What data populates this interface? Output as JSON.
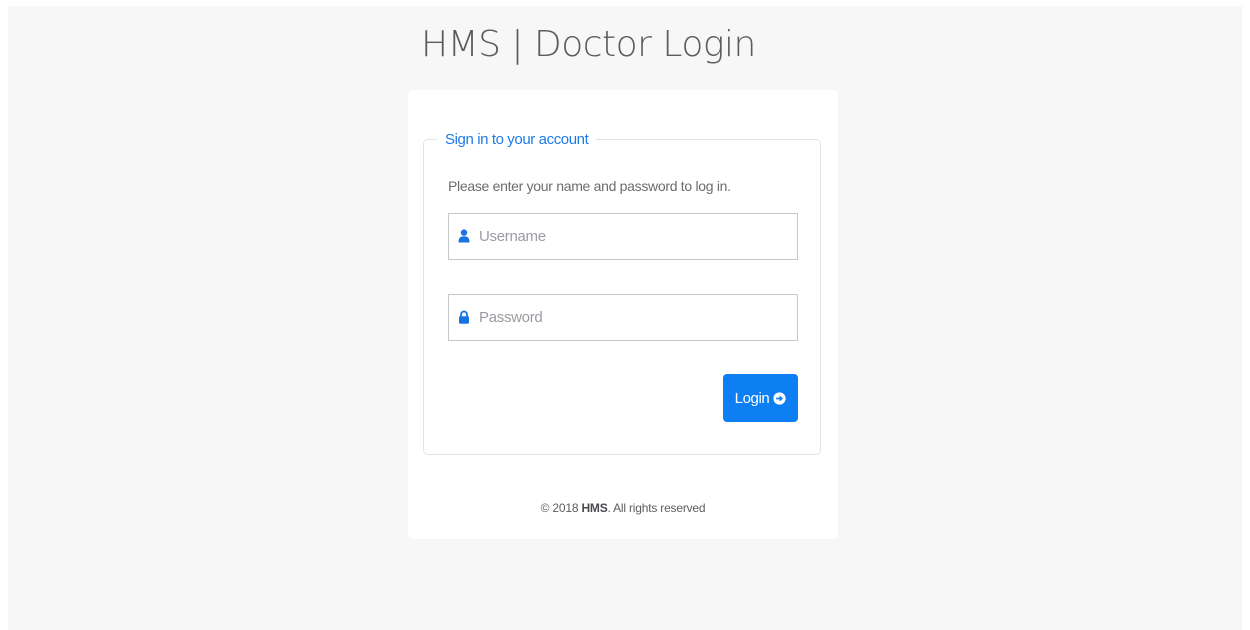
{
  "page": {
    "title": "HMS | Doctor Login"
  },
  "form": {
    "legend": "Sign in to your account",
    "instruction": "Please enter your name and password to log in.",
    "username": {
      "placeholder": "Username",
      "value": "",
      "icon": "user-icon"
    },
    "password": {
      "placeholder": "Password",
      "value": "",
      "icon": "lock-icon"
    },
    "submit": {
      "label": "Login",
      "icon": "arrow-circle-right-icon"
    }
  },
  "footer": {
    "prefix": "© 2018 ",
    "brand": "HMS",
    "suffix": ". All rights reserved"
  },
  "colors": {
    "accent": "#0d7ff2",
    "legend_text": "#1e7be6",
    "page_background": "#f7f7f8",
    "card_background": "#ffffff"
  }
}
